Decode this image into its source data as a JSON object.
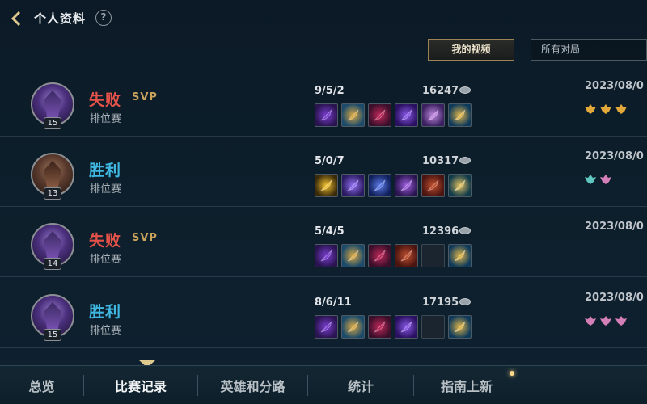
{
  "header": {
    "title": "个人资料",
    "help_symbol": "?"
  },
  "toolbar": {
    "my_video_label": "我的视频",
    "filter_value": "所有对局"
  },
  "matches": [
    {
      "result": "失败",
      "result_type": "lose",
      "svp": "SVP",
      "mode": "排位赛",
      "level": "15",
      "kda": "9/5/2",
      "gold": "16247",
      "date": "2023/08/0",
      "items": [
        "purple-staff",
        "gold-trident",
        "crimson-blade",
        "violet-orb",
        "purple-mask",
        "blue-boots"
      ],
      "badges": [
        "gold-flame-badge",
        "gold-flame-badge",
        "gold-flame-badge"
      ]
    },
    {
      "result": "胜利",
      "result_type": "win",
      "svp": "",
      "mode": "排位赛",
      "level": "13",
      "kda": "5/0/7",
      "gold": "10317",
      "date": "2023/08/0",
      "items": [
        "gold-orb",
        "violet-rune",
        "blue-wand",
        "purple-sword",
        "red-tome",
        "teal-boots"
      ],
      "badges": [
        "teal-shield-badge",
        "pink-wing-badge"
      ]
    },
    {
      "result": "失败",
      "result_type": "lose",
      "svp": "SVP",
      "mode": "排位赛",
      "level": "14",
      "kda": "5/4/5",
      "gold": "12396",
      "date": "2023/08/0",
      "items": [
        "purple-staff",
        "gold-trident",
        "crimson-blade",
        "red-tome",
        "",
        "blue-boots"
      ],
      "badges": []
    },
    {
      "result": "胜利",
      "result_type": "win",
      "svp": "",
      "mode": "排位赛",
      "level": "15",
      "kda": "8/6/11",
      "gold": "17195",
      "date": "2023/08/0",
      "items": [
        "purple-staff",
        "gold-trident",
        "crimson-blade",
        "violet-orb",
        "",
        "blue-boots"
      ],
      "badges": [
        "pink-wing-badge",
        "pink-wing-badge",
        "pink-wing-badge"
      ]
    }
  ],
  "nav": {
    "tabs": [
      "总览",
      "比赛记录",
      "英雄和分路",
      "统计",
      "指南上新"
    ],
    "active_index": 1
  },
  "colors": {
    "lose": "#e5524a",
    "win": "#3fb7e0",
    "svp": "#c9a25c",
    "accent_gold": "#9c8353"
  }
}
